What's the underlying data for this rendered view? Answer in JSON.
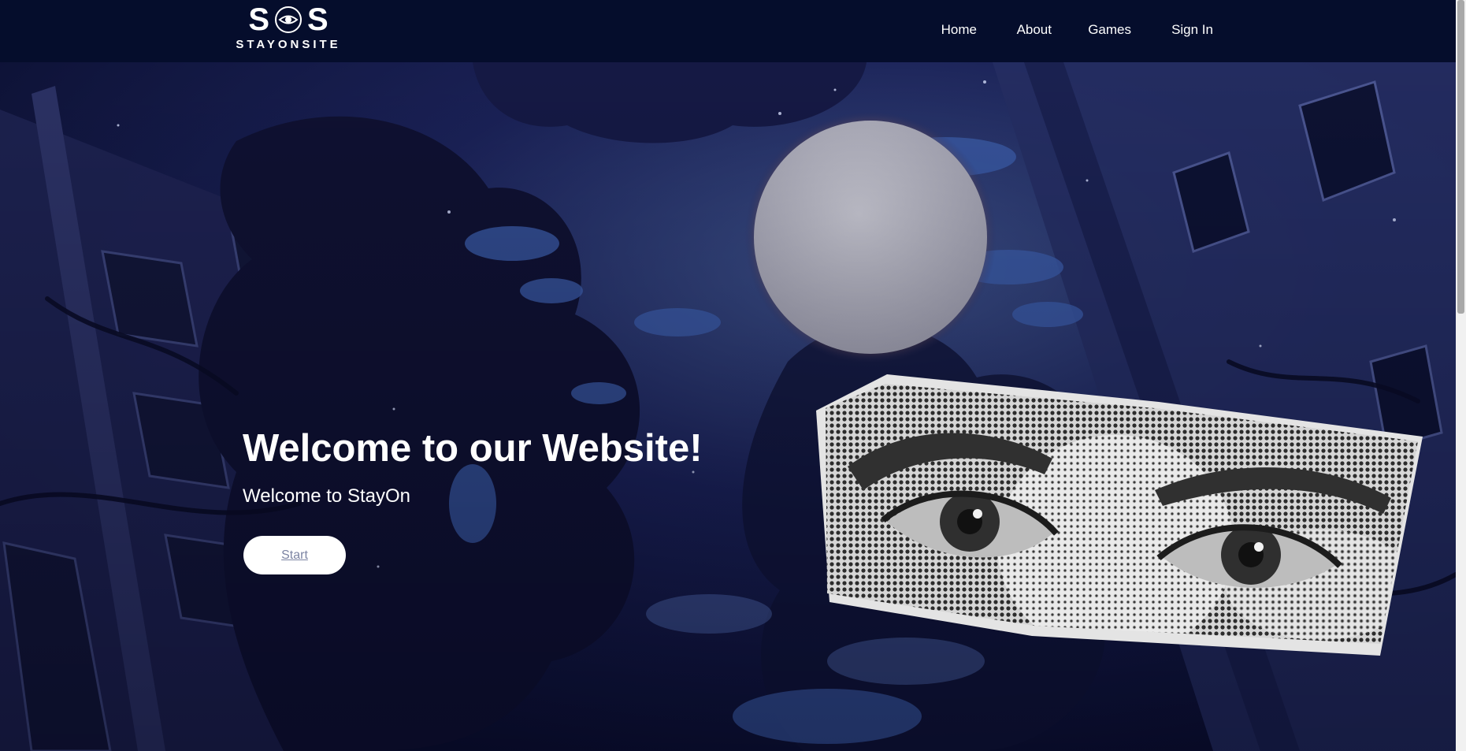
{
  "logo": {
    "letter_left": "S",
    "letter_right": "S",
    "wordmark": "STAYONSITE",
    "icon": "eye-icon"
  },
  "nav": {
    "items": [
      {
        "label": "Home"
      },
      {
        "label": "About"
      },
      {
        "label": "Games"
      },
      {
        "label": "Sign In"
      }
    ]
  },
  "hero": {
    "title": "Welcome to our Website!",
    "subtitle": "Welcome to StayOn",
    "button_label": "Start",
    "background": "night-sky-moon-illustration",
    "graphic": "halftone-eyes-cutout"
  },
  "colors": {
    "navbar": "#050d2c",
    "hero_dark": "#0c1236",
    "hero_blue": "#2d4a8c",
    "text": "#ffffff",
    "button_text": "#7c84a3"
  }
}
